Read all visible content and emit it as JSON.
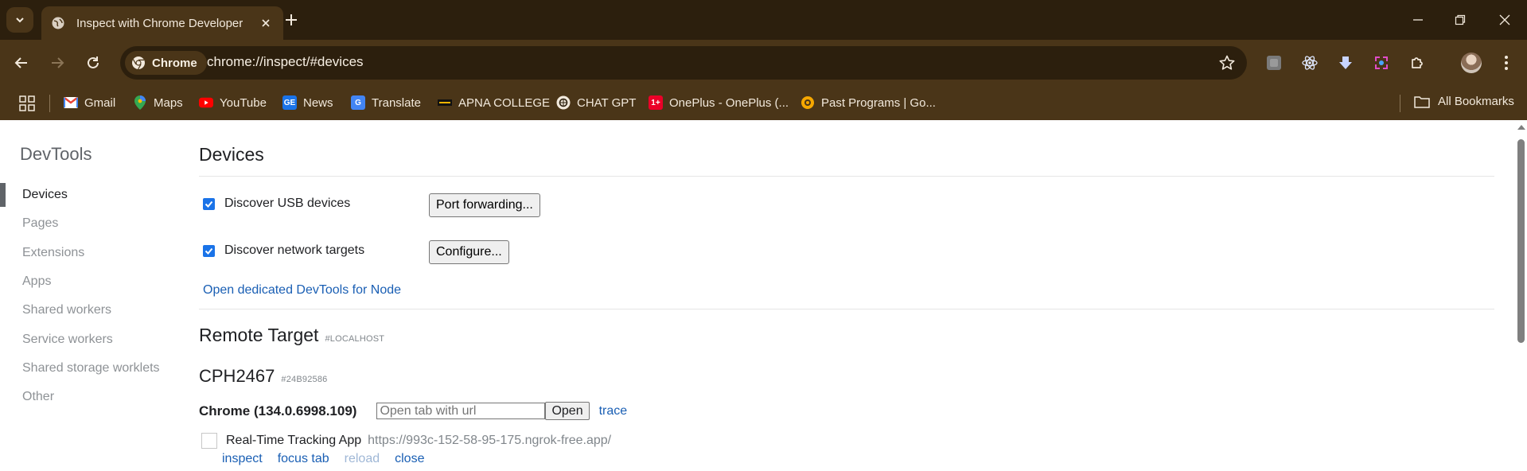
{
  "browser": {
    "tab_title": "Inspect with Chrome Developer",
    "chip_label": "Chrome",
    "url": "chrome://inspect/#devices"
  },
  "bookmarks": [
    {
      "label": "Gmail",
      "icon": "gmail-icon"
    },
    {
      "label": "Maps",
      "icon": "maps-icon"
    },
    {
      "label": "YouTube",
      "icon": "youtube-icon"
    },
    {
      "label": "News",
      "icon": "news-icon"
    },
    {
      "label": "Translate",
      "icon": "translate-icon"
    },
    {
      "label": "APNA COLLEGE",
      "icon": "apna-college-icon"
    },
    {
      "label": "CHAT GPT",
      "icon": "chatgpt-icon"
    },
    {
      "label": "OnePlus - OnePlus (...",
      "icon": "oneplus-icon"
    },
    {
      "label": "Past Programs | Go...",
      "icon": "google-programs-icon"
    }
  ],
  "all_bookmarks_label": "All Bookmarks",
  "sidebar": {
    "title": "DevTools",
    "items": [
      "Devices",
      "Pages",
      "Extensions",
      "Apps",
      "Shared workers",
      "Service workers",
      "Shared storage worklets",
      "Other"
    ],
    "active": "Devices"
  },
  "main": {
    "heading": "Devices",
    "usb_label": "Discover USB devices",
    "usb_checked": true,
    "port_forwarding_button": "Port forwarding...",
    "network_label": "Discover network targets",
    "network_checked": true,
    "configure_button": "Configure...",
    "node_link": "Open dedicated DevTools for Node",
    "remote_heading": "Remote Target",
    "remote_tag": "#LOCALHOST",
    "device_name": "CPH2467",
    "device_id": "#24B92586",
    "browser_version": "Chrome (134.0.6998.109)",
    "open_tab_placeholder": "Open tab with url",
    "open_button": "Open",
    "trace_link": "trace",
    "target": {
      "title": "Real-Time Tracking App",
      "url": "https://993c-152-58-95-175.ngrok-free.app/"
    },
    "actions": {
      "inspect": "inspect",
      "focus": "focus tab",
      "reload": "reload",
      "close": "close"
    }
  },
  "colors": {
    "frame_dark": "#2c1f0d",
    "frame": "#4a3518",
    "link": "#1a5fb4",
    "checkbox": "#1a73e8"
  }
}
